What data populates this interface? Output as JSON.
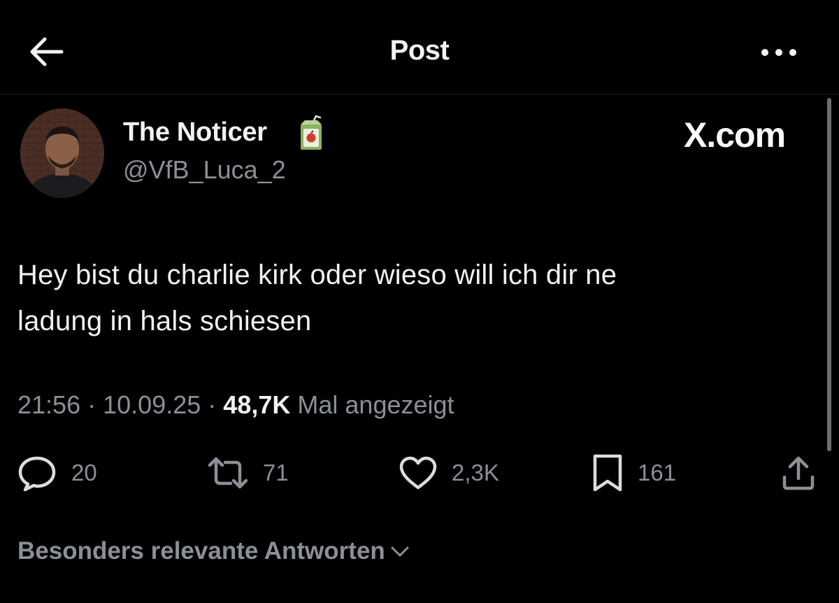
{
  "header": {
    "title": "Post",
    "back_icon": "arrow-left-icon",
    "more_icon": "more-horizontal-icon"
  },
  "post": {
    "author": {
      "display_name": "The Noticer",
      "handle": "@VfB_Luca_2",
      "badge_icon": "juice-box-icon"
    },
    "watermark": "X.com",
    "text_lines": [
      "Hey bist du charlie kirk oder wieso will ich dir ne",
      "ladung in hals schiesen"
    ],
    "time": "21:56",
    "date": "10.09.25",
    "separator": "·",
    "views_count": "48,7K",
    "views_label": "Mal angezeigt",
    "actions": {
      "replies": "20",
      "reposts": "71",
      "likes": "2,3K",
      "bookmarks": "161"
    }
  },
  "replies_sort": {
    "label": "Besonders relevante Antworten",
    "icon": "chevron-down-icon"
  },
  "colors": {
    "background": "#000000",
    "primary_text": "#e7e9ea",
    "secondary_text": "#8b9096"
  }
}
